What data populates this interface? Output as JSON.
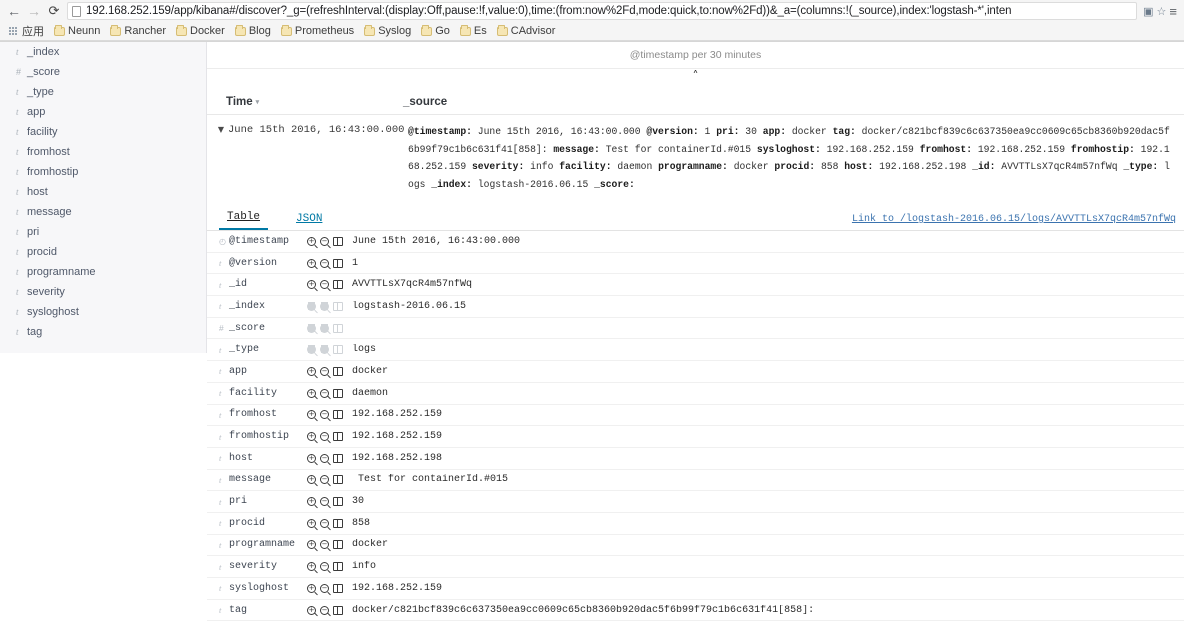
{
  "browser": {
    "url": "192.168.252.159/app/kibana#/discover?_g=(refreshInterval:(display:Off,pause:!f,value:0),time:(from:now%2Fd,mode:quick,to:now%2Fd))&_a=(columns:!(_source),index:'logstash-*',inten",
    "back_icon": "←",
    "forward_icon": "→",
    "reload_icon": "⟳",
    "star_icon": "☆",
    "cast_icon": "▣",
    "menu_icon": "≡",
    "bookmarks": [
      {
        "label": "应用",
        "icon": "apps-grid"
      },
      {
        "label": "Neunn",
        "icon": "folder"
      },
      {
        "label": "Rancher",
        "icon": "folder"
      },
      {
        "label": "Docker",
        "icon": "folder"
      },
      {
        "label": "Blog",
        "icon": "folder"
      },
      {
        "label": "Prometheus",
        "icon": "folder"
      },
      {
        "label": "Syslog",
        "icon": "folder"
      },
      {
        "label": "Go",
        "icon": "folder"
      },
      {
        "label": "Es",
        "icon": "folder"
      },
      {
        "label": "CAdvisor",
        "icon": "folder"
      }
    ]
  },
  "sidebar": {
    "fields": [
      {
        "type": "t",
        "name": "_index"
      },
      {
        "type": "#",
        "name": "_score"
      },
      {
        "type": "t",
        "name": "_type"
      },
      {
        "type": "t",
        "name": "app"
      },
      {
        "type": "t",
        "name": "facility"
      },
      {
        "type": "t",
        "name": "fromhost"
      },
      {
        "type": "t",
        "name": "fromhostip"
      },
      {
        "type": "t",
        "name": "host"
      },
      {
        "type": "t",
        "name": "message"
      },
      {
        "type": "t",
        "name": "pri"
      },
      {
        "type": "t",
        "name": "procid"
      },
      {
        "type": "t",
        "name": "programname"
      },
      {
        "type": "t",
        "name": "severity"
      },
      {
        "type": "t",
        "name": "sysloghost"
      },
      {
        "type": "t",
        "name": "tag"
      }
    ]
  },
  "chart": {
    "label": "@timestamp per 30 minutes",
    "collapse_icon": "˄"
  },
  "doc_table": {
    "header": {
      "time": "Time",
      "sort_caret": "▾",
      "source": "_source"
    },
    "row": {
      "expand_icon": "▼",
      "time": "June 15th 2016, 16:43:00.000",
      "source_pairs": [
        {
          "key": "@timestamp:",
          "value": "June 15th 2016, 16:43:00.000"
        },
        {
          "key": "@version:",
          "value": "1"
        },
        {
          "key": "pri:",
          "value": "30"
        },
        {
          "key": "app:",
          "value": "docker"
        },
        {
          "key": "tag:",
          "value": "docker/c821bcf839c6c637350ea9cc0609c65cb8360b920dac5f6b99f79c1b6c631f41[858]:"
        },
        {
          "key": "message:",
          "value": "Test for containerId.#015"
        },
        {
          "key": "sysloghost:",
          "value": "192.168.252.159"
        },
        {
          "key": "fromhost:",
          "value": "192.168.252.159"
        },
        {
          "key": "fromhostip:",
          "value": "192.168.252.159"
        },
        {
          "key": "severity:",
          "value": "info"
        },
        {
          "key": "facility:",
          "value": "daemon"
        },
        {
          "key": "programname:",
          "value": "docker"
        },
        {
          "key": "procid:",
          "value": "858"
        },
        {
          "key": "host:",
          "value": "192.168.252.198"
        },
        {
          "key": "_id:",
          "value": "AVVTTLsX7qcR4m57nfWq"
        },
        {
          "key": "_type:",
          "value": "logs"
        },
        {
          "key": "_index:",
          "value": "logstash-2016.06.15"
        },
        {
          "key": "_score:",
          "value": ""
        }
      ]
    }
  },
  "detail_view": {
    "tabs": [
      {
        "label": "Table",
        "active": true
      },
      {
        "label": "JSON",
        "active": false
      }
    ],
    "link_text": "Link to /logstash-2016.06.15/logs/AVVTTLsX7qcR4m57nfWq",
    "action_icons": {
      "filter_for": "positive-magnifier-icon",
      "filter_out": "negative-magnifier-icon",
      "toggle_column": "toggle-column-icon"
    },
    "rows": [
      {
        "type": "◴",
        "type_class": "clock",
        "name": "@timestamp",
        "value": "June 15th 2016, 16:43:00.000",
        "disabled": false
      },
      {
        "type": "t",
        "type_class": "str",
        "name": "@version",
        "value": "1",
        "disabled": false
      },
      {
        "type": "t",
        "type_class": "str",
        "name": "_id",
        "value": "AVVTTLsX7qcR4m57nfWq",
        "disabled": false
      },
      {
        "type": "t",
        "type_class": "str",
        "name": "_index",
        "value": "logstash-2016.06.15",
        "disabled": true
      },
      {
        "type": "#",
        "type_class": "num",
        "name": "_score",
        "value": "",
        "disabled": true
      },
      {
        "type": "t",
        "type_class": "str",
        "name": "_type",
        "value": "logs",
        "disabled": true
      },
      {
        "type": "t",
        "type_class": "str",
        "name": "app",
        "value": "docker",
        "disabled": false
      },
      {
        "type": "t",
        "type_class": "str",
        "name": "facility",
        "value": "daemon",
        "disabled": false
      },
      {
        "type": "t",
        "type_class": "str",
        "name": "fromhost",
        "value": "192.168.252.159",
        "disabled": false
      },
      {
        "type": "t",
        "type_class": "str",
        "name": "fromhostip",
        "value": "192.168.252.159",
        "disabled": false
      },
      {
        "type": "t",
        "type_class": "str",
        "name": "host",
        "value": "192.168.252.198",
        "disabled": false
      },
      {
        "type": "t",
        "type_class": "str",
        "name": "message",
        "value": " Test for containerId.#015",
        "disabled": false
      },
      {
        "type": "t",
        "type_class": "str",
        "name": "pri",
        "value": "30",
        "disabled": false
      },
      {
        "type": "t",
        "type_class": "str",
        "name": "procid",
        "value": "858",
        "disabled": false
      },
      {
        "type": "t",
        "type_class": "str",
        "name": "programname",
        "value": "docker",
        "disabled": false
      },
      {
        "type": "t",
        "type_class": "str",
        "name": "severity",
        "value": "info",
        "disabled": false
      },
      {
        "type": "t",
        "type_class": "str",
        "name": "sysloghost",
        "value": "192.168.252.159",
        "disabled": false
      },
      {
        "type": "t",
        "type_class": "str",
        "name": "tag",
        "value": "docker/c821bcf839c6c637350ea9cc0609c65cb8360b920dac5f6b99f79c1b6c631f41[858]:",
        "disabled": false
      }
    ]
  }
}
